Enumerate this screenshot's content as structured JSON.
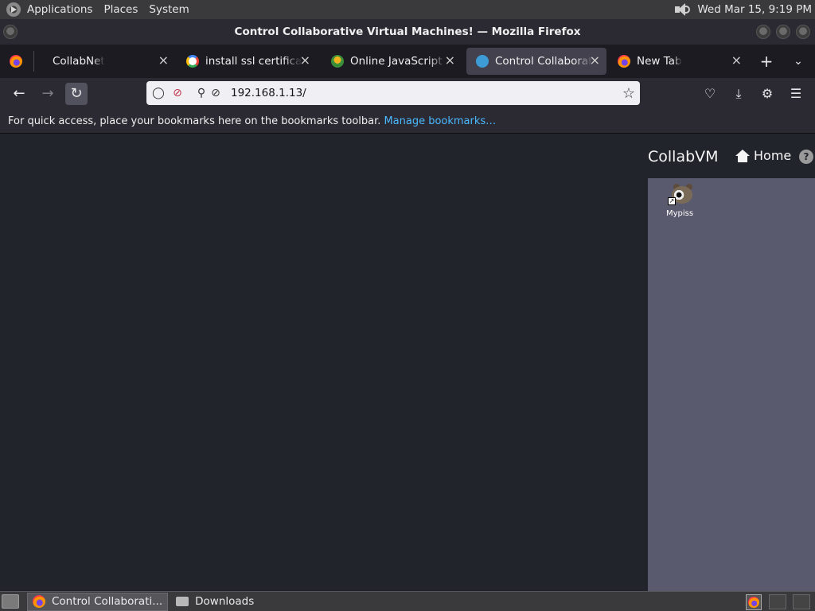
{
  "top_panel": {
    "menus": [
      "Applications",
      "Places",
      "System"
    ],
    "clock": "Wed Mar 15,  9:19 PM"
  },
  "window": {
    "title": "Control Collaborative Virtual Machines! — Mozilla Firefox"
  },
  "tabs": [
    {
      "label": "CollabNet",
      "favicon": "firefox-icon",
      "active": false
    },
    {
      "label": "install ssl certificate u",
      "favicon": "google-icon",
      "active": false
    },
    {
      "label": "Online JavaScript beau",
      "favicon": "javascript-beautifier-icon",
      "active": false
    },
    {
      "label": "Control Collaborative V",
      "favicon": "collabvm-icon",
      "active": true
    },
    {
      "label": "New Tab",
      "favicon": "firefox-icon",
      "active": false
    }
  ],
  "navbar": {
    "url": "192.168.1.13/"
  },
  "bookmarks_bar": {
    "message": "For quick access, place your bookmarks here on the bookmarks toolbar.",
    "link": "Manage bookmarks…"
  },
  "page": {
    "brand": "CollabVM",
    "home_label": "Home",
    "help_icon": "?",
    "vm_desktop_icon_label": "Mypiss"
  },
  "taskbar": {
    "tasks": [
      {
        "label": "Control Collaborati...",
        "active": true
      },
      {
        "label": "Downloads",
        "active": false
      }
    ]
  },
  "colors": {
    "accent_link": "#4ab9ff",
    "page_bg": "#21252b",
    "vm_screen_bg": "#5a5a6e"
  }
}
